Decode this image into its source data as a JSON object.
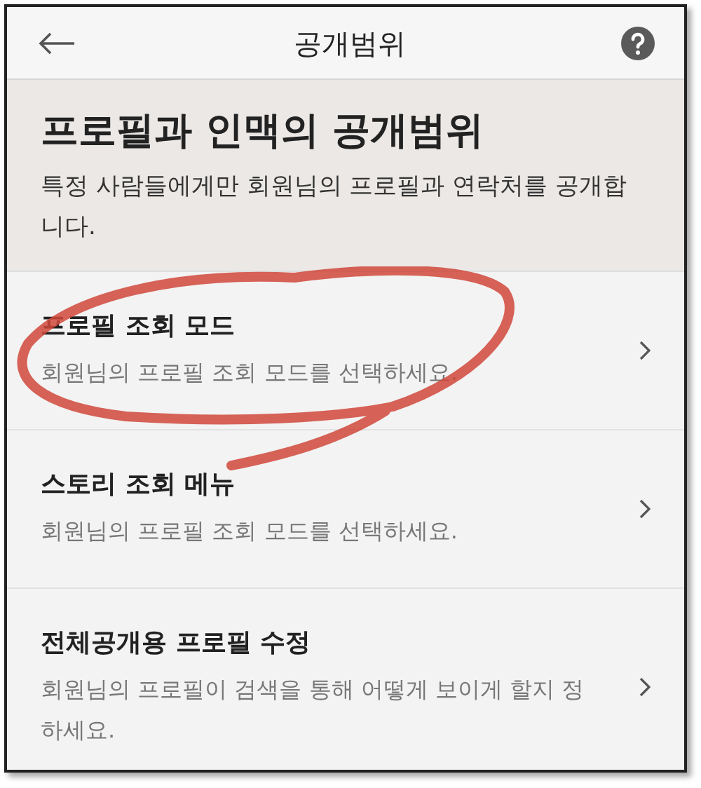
{
  "header": {
    "title": "공개범위"
  },
  "intro": {
    "heading": "프로필과 인맥의 공개범위",
    "description": "특정 사람들에게만 회원님의 프로필과 연락처를 공개합니다."
  },
  "items": [
    {
      "title": "프로필 조회 모드",
      "subtitle": "회원님의 프로필 조회 모드를 선택하세요."
    },
    {
      "title": "스토리 조회 메뉴",
      "subtitle": "회원님의 프로필 조회 모드를 선택하세요."
    },
    {
      "title": "전체공개용 프로필 수정",
      "subtitle": "회원님의 프로필이 검색을 통해 어떻게 보이게 할지 정하세요."
    }
  ]
}
